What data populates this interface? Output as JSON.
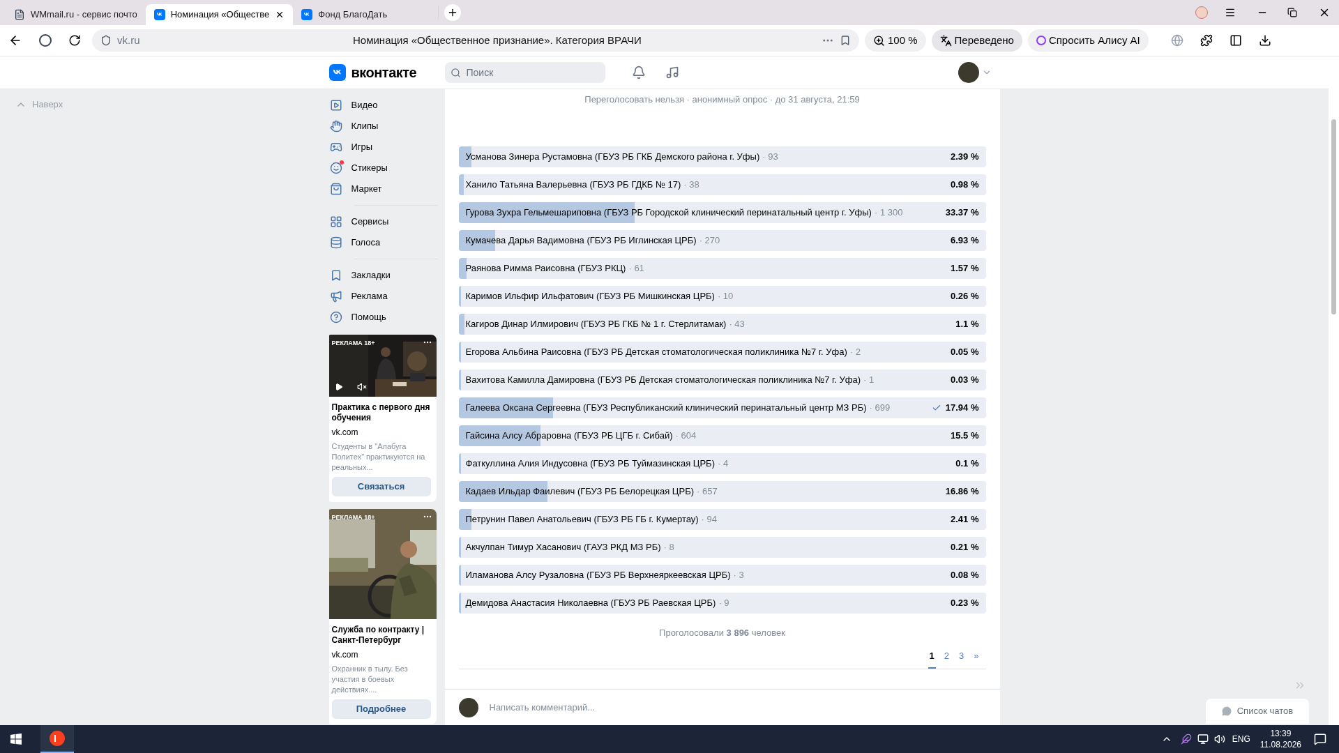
{
  "browser": {
    "tabs": [
      {
        "title": "WMmail.ru - сервис почто",
        "kind": "page",
        "selected": false
      },
      {
        "title": "Номинация «Обществе",
        "kind": "vk",
        "selected": true
      },
      {
        "title": "Фонд БлагоДать",
        "kind": "vk",
        "selected": false
      }
    ],
    "address": {
      "url": "vk.ru",
      "page_title": "Номинация «Общественное признание». Категория ВРАЧИ"
    },
    "zoom": "100 %",
    "translate": "Переведено",
    "alice": "Спросить Алису AI"
  },
  "header": {
    "logo": "вконтакте",
    "search_placeholder": "Поиск"
  },
  "back_to_top": "Наверх",
  "sidebar": {
    "groups": [
      [
        {
          "label": "Видео",
          "notification": false
        },
        {
          "label": "Клипы",
          "notification": false
        },
        {
          "label": "Игры",
          "notification": false
        },
        {
          "label": "Стикеры",
          "notification": true
        },
        {
          "label": "Маркет",
          "notification": false
        }
      ],
      [
        {
          "label": "Сервисы",
          "notification": false
        },
        {
          "label": "Голоса",
          "notification": false
        }
      ],
      [
        {
          "label": "Закладки",
          "notification": false
        },
        {
          "label": "Реклама",
          "notification": false
        },
        {
          "label": "Помощь",
          "notification": false
        }
      ]
    ]
  },
  "ads": [
    {
      "kind": "video",
      "label": "РЕКЛАМА 18+",
      "title": "Практика с первого дня обучения",
      "domain": "vk.com",
      "description": "Студенты в \"Алабуга Политех\" практикуются на реальных...",
      "button": "Связаться"
    },
    {
      "label": "РЕКЛАМА 18+",
      "title": "Служба по контракту | Санкт-Петербург",
      "domain": "vk.com",
      "description": "Охранник в тылу. Без участия в боевых действиях....",
      "button": "Подробнее"
    }
  ],
  "poll": {
    "meta": "Переголосовать нельзя · анонимный опрос · до 31 августа, 21:59",
    "options": [
      {
        "text": "Усманова Зинера Рустамовна (ГБУЗ РБ ГКБ Демского района г. Уфы)",
        "count": "· 93",
        "percent": "2.39 %",
        "level": 0.0239,
        "voted": false
      },
      {
        "text": "Ханило Татьяна Валерьевна (ГБУЗ РБ ГДКБ № 17)",
        "count": "· 38",
        "percent": "0.98 %",
        "level": 0.0098,
        "voted": false
      },
      {
        "text": "Гурова Зухра Гельмешариповна (ГБУЗ РБ Городской клинический перинатальный центр г. Уфы)",
        "count": "· 1 300",
        "percent": "33.37 %",
        "level": 0.3337,
        "voted": false
      },
      {
        "text": "Кумачева Дарья Вадимовна (ГБУЗ РБ Иглинская ЦРБ)",
        "count": "· 270",
        "percent": "6.93 %",
        "level": 0.0693,
        "voted": false
      },
      {
        "text": "Раянова Римма Раисовна (ГБУЗ РКЦ)",
        "count": "· 61",
        "percent": "1.57 %",
        "level": 0.0157,
        "voted": false
      },
      {
        "text": "Каримов Ильфир Ильфатович (ГБУЗ РБ Мишкинская ЦРБ)",
        "count": "· 10",
        "percent": "0.26 %",
        "level": 0.0026,
        "voted": false
      },
      {
        "text": "Кагиров Динар Илмирович (ГБУЗ РБ ГКБ № 1 г. Стерлитамак)",
        "count": "· 43",
        "percent": "1.1 %",
        "level": 0.011,
        "voted": false
      },
      {
        "text": "Егорова Альбина Раисовна (ГБУЗ РБ Детская стоматологическая поликлиника №7 г. Уфа)",
        "count": "· 2",
        "percent": "0.05 %",
        "level": 0.0005,
        "voted": false
      },
      {
        "text": "Вахитова Камилла Дамировна (ГБУЗ РБ Детская стоматологическая поликлиника №7 г. Уфа)",
        "count": "· 1",
        "percent": "0.03 %",
        "level": 0.0003,
        "voted": false
      },
      {
        "text": "Галеева Оксана Сергеевна (ГБУЗ Республиканский клинический перинатальный центр МЗ РБ)",
        "count": "· 699",
        "percent": "17.94 %",
        "level": 0.1794,
        "voted": true
      },
      {
        "text": "Гайсина Алсу Абраровна (ГБУЗ РБ ЦГБ г. Сибай)",
        "count": "· 604",
        "percent": "15.5 %",
        "level": 0.155,
        "voted": false
      },
      {
        "text": "Фаткуллина Алия Индусовна (ГБУЗ РБ Туймазинская ЦРБ)",
        "count": "· 4",
        "percent": "0.1 %",
        "level": 0.001,
        "voted": false
      },
      {
        "text": "Кадаев Ильдар Фаилевич (ГБУЗ РБ Белорецкая ЦРБ)",
        "count": "· 657",
        "percent": "16.86 %",
        "level": 0.1686,
        "voted": false
      },
      {
        "text": "Петрунин Павел Анатольевич (ГБУЗ РБ ГБ г. Кумертау)",
        "count": "· 94",
        "percent": "2.41 %",
        "level": 0.0241,
        "voted": false
      },
      {
        "text": "Акчулпан Тимур Хасанович (ГАУЗ РКД МЗ РБ)",
        "count": "· 8",
        "percent": "0.21 %",
        "level": 0.0021,
        "voted": false
      },
      {
        "text": "Иламанова Алсу Рузаловна (ГБУЗ РБ Верхнеяркеевская ЦРБ)",
        "count": "· 3",
        "percent": "0.08 %",
        "level": 0.0008,
        "voted": false
      },
      {
        "text": "Демидова Анастасия Николаевна (ГБУЗ РБ Раевская ЦРБ)",
        "count": "· 9",
        "percent": "0.23 %",
        "level": 0.0023,
        "voted": false
      }
    ],
    "total": "Проголосовали **3 896** человек",
    "pages": [
      {
        "label": "1",
        "selected": true
      },
      {
        "label": "2",
        "selected": false
      },
      {
        "label": "3",
        "selected": false
      },
      {
        "label": "»",
        "selected": false
      }
    ]
  },
  "comment": {
    "placeholder": "Написать комментарий..."
  },
  "chat_list": "Список чатов",
  "taskbar": {
    "language": "ENG",
    "time": "13:39",
    "date": "11.08.2026"
  }
}
